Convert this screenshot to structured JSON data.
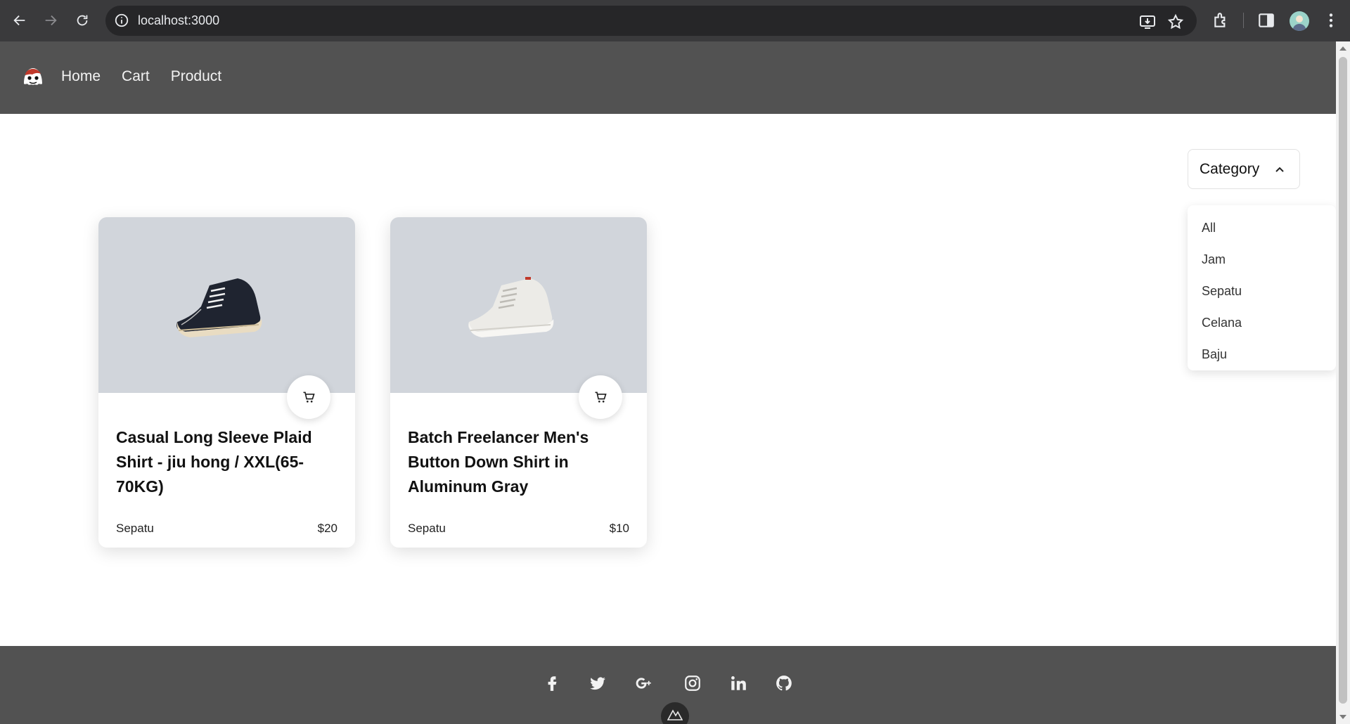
{
  "browser": {
    "url": "localhost:3000"
  },
  "header": {
    "menu": [
      "Home",
      "Cart",
      "Product"
    ]
  },
  "filter": {
    "button_label": "Category",
    "options": [
      "All",
      "Jam",
      "Sepatu",
      "Celana",
      "Baju"
    ]
  },
  "products": [
    {
      "title": "Casual Long Sleeve Plaid Shirt - jiu hong / XXL(65-70KG)",
      "category": "Sepatu",
      "price": "$20",
      "shoe_color": "#1f2430"
    },
    {
      "title": "Batch Freelancer Men's Button Down Shirt in Aluminum Gray",
      "category": "Sepatu",
      "price": "$10",
      "shoe_color": "#ecebe7"
    }
  ],
  "footer": {
    "social_icons": [
      "facebook-icon",
      "twitter-icon",
      "google-plus-icon",
      "instagram-icon",
      "linkedin-icon",
      "github-icon"
    ]
  },
  "colors": {
    "header_bg": "#525252",
    "image_bg": "#d1d5db"
  }
}
